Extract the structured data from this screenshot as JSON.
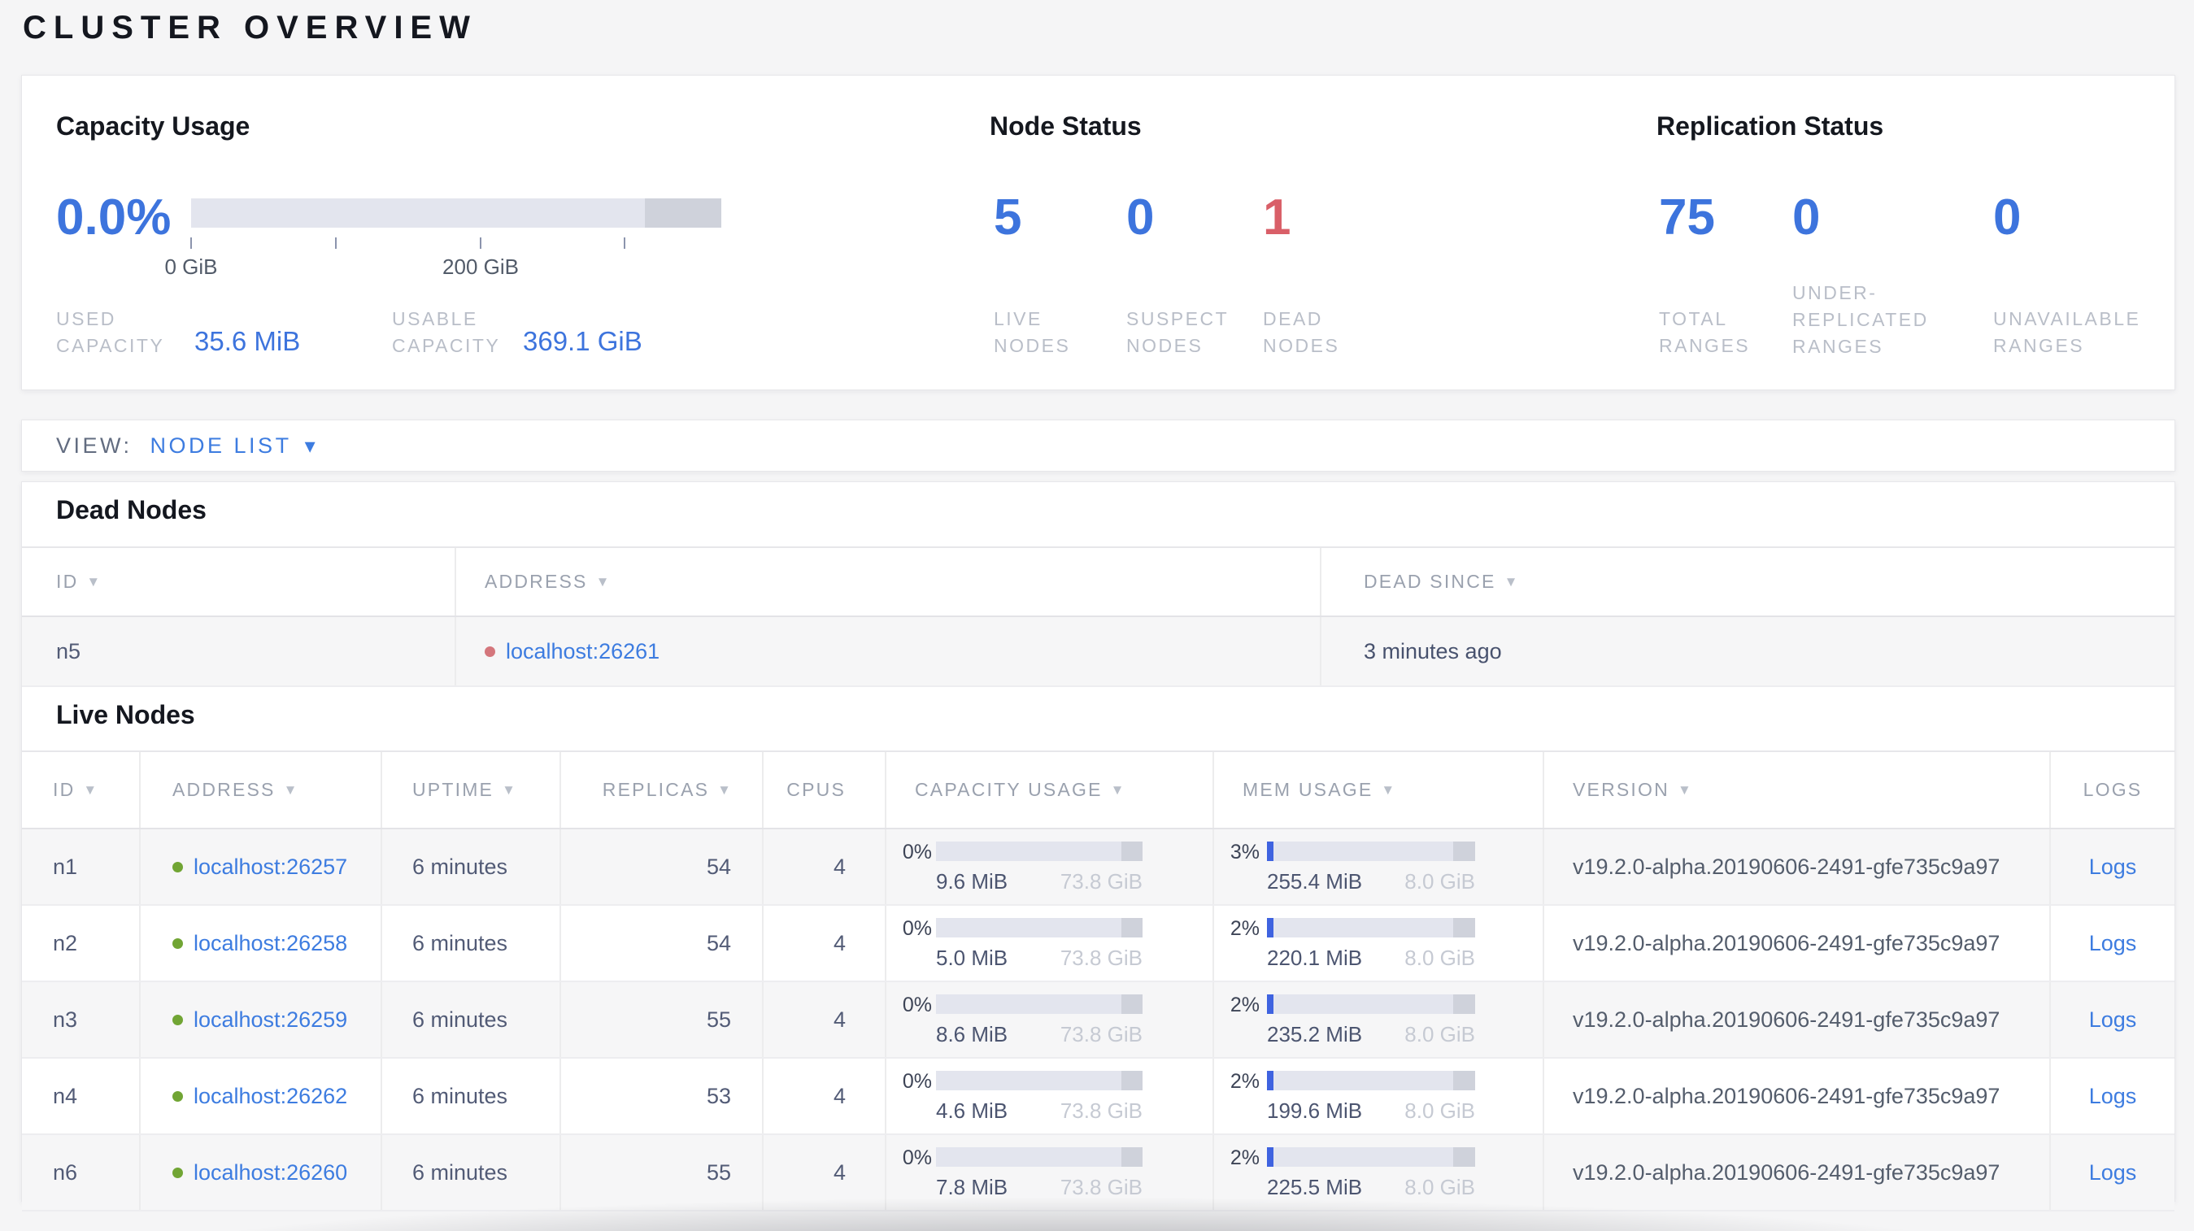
{
  "page": {
    "title": "CLUSTER OVERVIEW"
  },
  "icons": {
    "sort_desc": "▼",
    "dropdown_caret": "▾"
  },
  "colors": {
    "accent_blue": "#3d74dd",
    "danger_red": "#d95f68",
    "link_blue": "#3d7ce0",
    "live_dot_green": "#71a534",
    "dead_dot_red": "#d4767c",
    "bar_track": "#e3e5ee",
    "bar_reserved": "#cfd2db",
    "bar_used_blue": "#3f63e0"
  },
  "summary": {
    "capacity": {
      "title": "Capacity Usage",
      "percent": "0.0%",
      "axis_tick_0": "0 GiB",
      "axis_tick_200": "200 GiB",
      "used_label": "USED CAPACITY",
      "used_value": "35.6 MiB",
      "usable_label": "USABLE CAPACITY",
      "usable_value": "369.1 GiB"
    },
    "node_status": {
      "title": "Node Status",
      "stats": [
        {
          "value": "5",
          "label": "LIVE NODES"
        },
        {
          "value": "0",
          "label": "SUSPECT NODES"
        },
        {
          "value": "1",
          "label": "DEAD NODES"
        }
      ]
    },
    "replication": {
      "title": "Replication Status",
      "stats": [
        {
          "value": "75",
          "label": "TOTAL RANGES"
        },
        {
          "value": "0",
          "label": "UNDER-REPLICATED RANGES"
        },
        {
          "value": "0",
          "label": "UNAVAILABLE RANGES"
        }
      ]
    }
  },
  "view_bar": {
    "label": "VIEW:",
    "selected": "NODE LIST"
  },
  "dead_nodes": {
    "title": "Dead Nodes",
    "columns": {
      "id": "ID",
      "address": "ADDRESS",
      "dead_since": "DEAD SINCE"
    },
    "rows": [
      {
        "id": "n5",
        "address": "localhost:26261",
        "dead_since": "3 minutes ago"
      }
    ]
  },
  "live_nodes": {
    "title": "Live Nodes",
    "columns": {
      "id": "ID",
      "address": "ADDRESS",
      "uptime": "UPTIME",
      "replicas": "REPLICAS",
      "cpus": "CPUS",
      "capacity": "CAPACITY USAGE",
      "mem": "MEM USAGE",
      "version": "VERSION",
      "logs": "LOGS"
    },
    "rows": [
      {
        "id": "n1",
        "address": "localhost:26257",
        "uptime": "6 minutes",
        "replicas": "54",
        "cpus": "4",
        "cap_pct": "0%",
        "cap_used": "9.6 MiB",
        "cap_total": "73.8 GiB",
        "mem_pct": "3%",
        "mem_used": "255.4 MiB",
        "mem_total": "8.0 GiB",
        "version": "v19.2.0-alpha.20190606-2491-gfe735c9a97",
        "logs": "Logs"
      },
      {
        "id": "n2",
        "address": "localhost:26258",
        "uptime": "6 minutes",
        "replicas": "54",
        "cpus": "4",
        "cap_pct": "0%",
        "cap_used": "5.0 MiB",
        "cap_total": "73.8 GiB",
        "mem_pct": "2%",
        "mem_used": "220.1 MiB",
        "mem_total": "8.0 GiB",
        "version": "v19.2.0-alpha.20190606-2491-gfe735c9a97",
        "logs": "Logs"
      },
      {
        "id": "n3",
        "address": "localhost:26259",
        "uptime": "6 minutes",
        "replicas": "55",
        "cpus": "4",
        "cap_pct": "0%",
        "cap_used": "8.6 MiB",
        "cap_total": "73.8 GiB",
        "mem_pct": "2%",
        "mem_used": "235.2 MiB",
        "mem_total": "8.0 GiB",
        "version": "v19.2.0-alpha.20190606-2491-gfe735c9a97",
        "logs": "Logs"
      },
      {
        "id": "n4",
        "address": "localhost:26262",
        "uptime": "6 minutes",
        "replicas": "53",
        "cpus": "4",
        "cap_pct": "0%",
        "cap_used": "4.6 MiB",
        "cap_total": "73.8 GiB",
        "mem_pct": "2%",
        "mem_used": "199.6 MiB",
        "mem_total": "8.0 GiB",
        "version": "v19.2.0-alpha.20190606-2491-gfe735c9a97",
        "logs": "Logs"
      },
      {
        "id": "n6",
        "address": "localhost:26260",
        "uptime": "6 minutes",
        "replicas": "55",
        "cpus": "4",
        "cap_pct": "0%",
        "cap_used": "7.8 MiB",
        "cap_total": "73.8 GiB",
        "mem_pct": "2%",
        "mem_used": "225.5 MiB",
        "mem_total": "8.0 GiB",
        "version": "v19.2.0-alpha.20190606-2491-gfe735c9a97",
        "logs": "Logs"
      }
    ]
  }
}
